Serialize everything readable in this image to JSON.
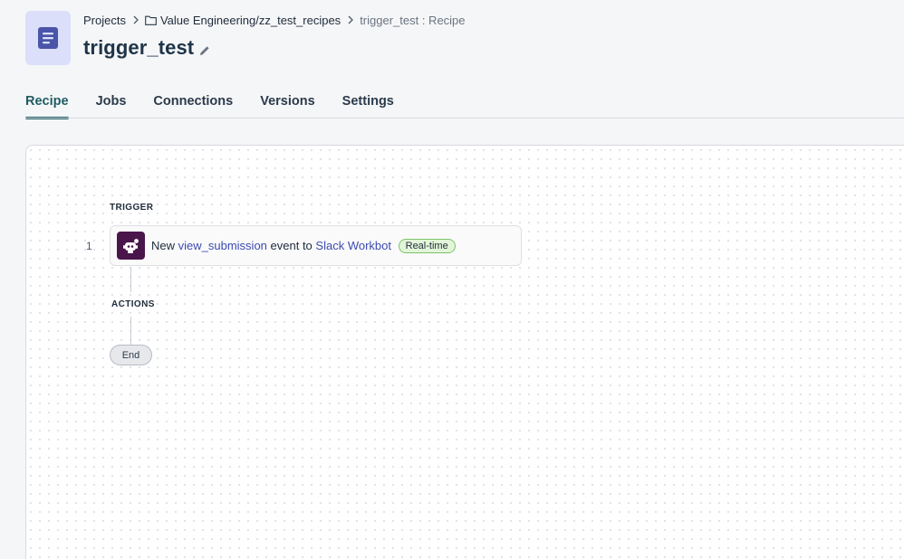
{
  "breadcrumb": {
    "projects": "Projects",
    "folder": "Value Engineering/zz_test_recipes",
    "current": "trigger_test : Recipe"
  },
  "page": {
    "title": "trigger_test"
  },
  "tabs": [
    "Recipe",
    "Jobs",
    "Connections",
    "Versions",
    "Settings"
  ],
  "active_tab": "Recipe",
  "canvas": {
    "trigger_label": "TRIGGER",
    "actions_label": "ACTIONS",
    "end_label": "End",
    "step": {
      "number": "1",
      "prefix": "New",
      "event": "view_submission",
      "middle": "event to",
      "app": "Slack Workbot",
      "badge": "Real-time"
    }
  },
  "colors": {
    "accent_tab": "#1e5c63",
    "slack_icon_bg": "#4a154b",
    "link": "#3d4bb0",
    "badge_bg": "#e3f5d8",
    "app_icon_bg": "#dcdffa"
  },
  "icons": [
    "recipe-icon",
    "chevron-right-icon",
    "folder-icon",
    "pencil-icon",
    "slack-workbot-icon"
  ]
}
